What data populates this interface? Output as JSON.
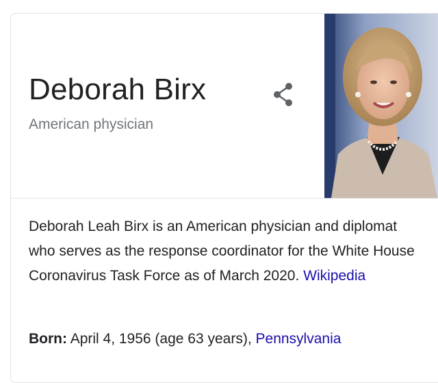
{
  "panel": {
    "title": "Deborah Birx",
    "subtitle": "American physician",
    "share_icon": "share-icon",
    "photo_icon": "portrait-photo"
  },
  "description": {
    "text": "Deborah Leah Birx is an American physician and diplomat who serves as the response coordinator for the White House Coronavirus Task Force as of March 2020.",
    "source_link": "Wikipedia"
  },
  "facts": {
    "born_label": "Born:",
    "born_value": "April 4, 1956 (age 63 years), ",
    "born_place_link": "Pennsylvania"
  },
  "colors": {
    "link": "#1a0dab",
    "title": "#202124",
    "subtitle": "#70757a"
  }
}
